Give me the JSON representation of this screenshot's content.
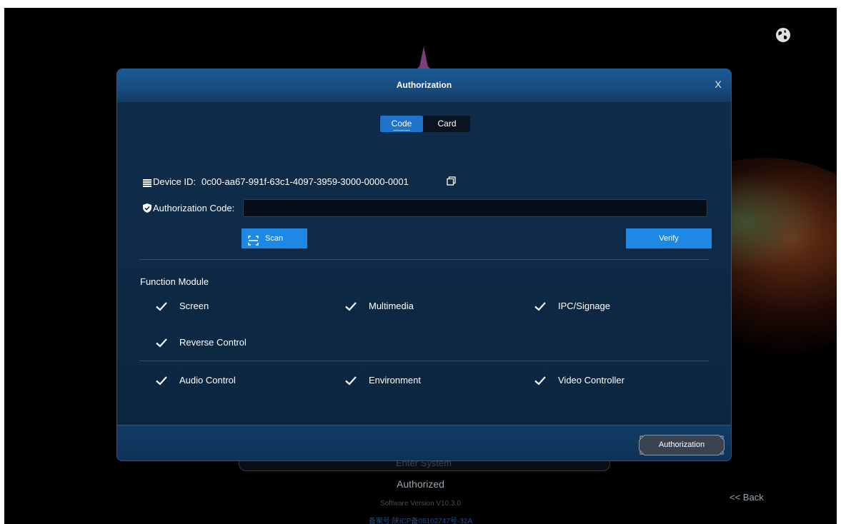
{
  "dialog": {
    "title": "Authorization",
    "close_label": "X",
    "tabs": {
      "code": "Code",
      "card": "Card"
    },
    "device_id_label": "Device ID:",
    "device_id_value": "0c00-aa67-991f-63c1-4097-3959-3000-0000-0001",
    "auth_code_label": "Authorization Code:",
    "auth_code_value": "",
    "scan_label": "Scan",
    "verify_label": "Verify",
    "function_module_title": "Function Module",
    "modules": {
      "screen": "Screen",
      "multimedia": "Multimedia",
      "ipc_signage": "IPC/Signage",
      "reverse_control": "Reverse Control",
      "audio_control": "Audio Control",
      "environment": "Environment",
      "video_controller": "Video Controller"
    },
    "footer_button": "Authorization"
  },
  "background": {
    "enter_system": "Enter System",
    "status": "Authorized",
    "version": "Software Version V10.3.0",
    "icp": "备案号:陕ICP备08102747号-32A",
    "back": "<< Back"
  },
  "colors": {
    "accent": "#1e88e5",
    "dialog_bg": "#0e2a45",
    "header": "#1c5a95"
  }
}
